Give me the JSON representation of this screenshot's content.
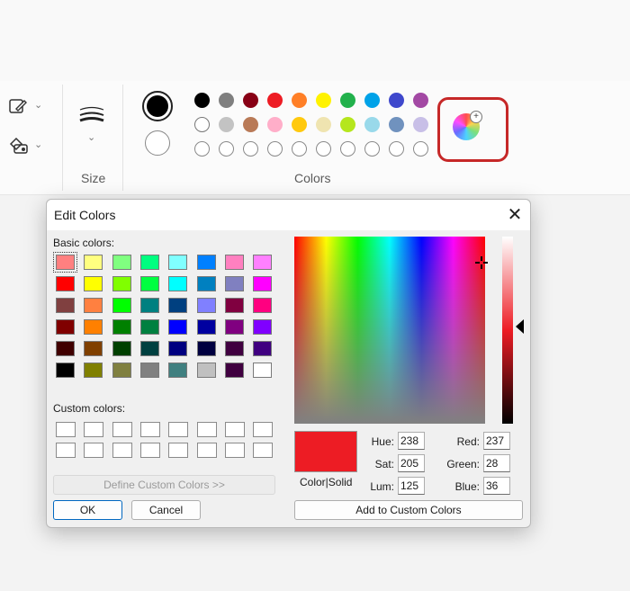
{
  "ribbon": {
    "size_label": "Size",
    "colors_label": "Colors",
    "chevron": "⌄",
    "tools": [
      {
        "icon": "pencil-icon"
      },
      {
        "icon": "fill-shapes-icon"
      }
    ],
    "brush_size_icon": "brush-size-icon",
    "primary_color": "#000000",
    "secondary_color": "#ffffff",
    "palette_row1": [
      "#000000",
      "#7f7f7f",
      "#880015",
      "#ed1c24",
      "#ff7f27",
      "#fff200",
      "#22b14c",
      "#00a2e8",
      "#3f48cc",
      "#a349a4"
    ],
    "palette_row2": [
      "#ffffff",
      "#c3c3c3",
      "#b97a57",
      "#ffaec9",
      "#ffc90e",
      "#efe4b0",
      "#b5e61d",
      "#99d9ea",
      "#7092be",
      "#c8bfe7"
    ],
    "palette_row3": [
      "",
      "",
      "",
      "",
      "",
      "",
      "",
      "",
      "",
      ""
    ],
    "edit_colors_icon": "color-wheel-icon",
    "plus": "+"
  },
  "dialog": {
    "title": "Edit Colors",
    "close": "✕",
    "basic_colors_label": "Basic colors:",
    "custom_colors_label": "Custom colors:",
    "basic_colors": [
      [
        "#ff8080",
        "#ffff80",
        "#80ff80",
        "#00ff80",
        "#80ffff",
        "#0080ff",
        "#ff80c0",
        "#ff80ff"
      ],
      [
        "#ff0000",
        "#ffff00",
        "#80ff00",
        "#00ff40",
        "#00ffff",
        "#0080c0",
        "#8080c0",
        "#ff00ff"
      ],
      [
        "#804040",
        "#ff8040",
        "#00ff00",
        "#008080",
        "#004080",
        "#8080ff",
        "#800040",
        "#ff0080"
      ],
      [
        "#800000",
        "#ff8000",
        "#008000",
        "#008040",
        "#0000ff",
        "#0000a0",
        "#800080",
        "#8000ff"
      ],
      [
        "#400000",
        "#804000",
        "#004000",
        "#004040",
        "#000080",
        "#000040",
        "#400040",
        "#400080"
      ],
      [
        "#000000",
        "#808000",
        "#808040",
        "#808080",
        "#408080",
        "#c0c0c0",
        "#400040",
        "#ffffff"
      ]
    ],
    "define_custom": "Define Custom Colors >>",
    "ok": "OK",
    "cancel": "Cancel",
    "add_custom": "Add to Custom Colors",
    "color_solid": "Color|Solid",
    "preview_color": "#ed1c24",
    "hue_label": "Hue:",
    "hue": "238",
    "sat_label": "Sat:",
    "sat": "205",
    "lum_label": "Lum:",
    "lum": "125",
    "red_label": "Red:",
    "red": "237",
    "green_label": "Green:",
    "green": "28",
    "blue_label": "Blue:",
    "blue": "36"
  }
}
